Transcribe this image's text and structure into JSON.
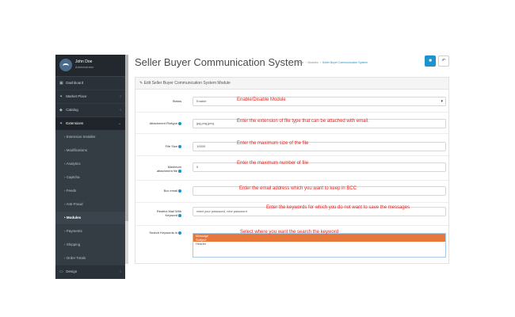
{
  "user": {
    "name": "John Doe",
    "role": "Administrator"
  },
  "sidebar": {
    "items": [
      {
        "label": "Dashboard",
        "icon": "dashboard-icon",
        "glyph": "▣",
        "arrow": ""
      },
      {
        "label": "Market Place",
        "icon": "puzzle-icon",
        "glyph": "✦",
        "arrow": "‹"
      },
      {
        "label": "Catalog",
        "icon": "tag-icon",
        "glyph": "◆",
        "arrow": "‹"
      },
      {
        "label": "Extensions",
        "icon": "puzzle-piece-icon",
        "glyph": "✦",
        "arrow": "⌄"
      }
    ],
    "subitems": [
      {
        "label": "Extension Installer"
      },
      {
        "label": "Modifications"
      },
      {
        "label": "Analytics"
      },
      {
        "label": "Captcha"
      },
      {
        "label": "Feeds"
      },
      {
        "label": "Anti-Fraud"
      },
      {
        "label": "Modules"
      },
      {
        "label": "Payments"
      },
      {
        "label": "Shipping"
      },
      {
        "label": "Order Totals"
      }
    ],
    "bottom": {
      "label": "Design",
      "icon": "monitor-icon",
      "glyph": "▭",
      "arrow": "‹"
    }
  },
  "header": {
    "title": "Seller Buyer Communication System",
    "breadcrumb": [
      "Home",
      "Modules",
      "Seller Buyer Communication System"
    ],
    "save_glyph": "■",
    "back_glyph": "↶"
  },
  "panel": {
    "heading": "Edit Seller Buyer Communication System Module",
    "status": {
      "label": "Status",
      "value": "Enable",
      "note": "Enable/Disable Module"
    },
    "attachment_filetype": {
      "label": "Attachment Filetype",
      "value": "jpg,png,jpeg",
      "note": "Enter the extension of file type that can be attached with email."
    },
    "file_size": {
      "label": "File Size",
      "value": "10000",
      "note": "Enter the maximum size of the file"
    },
    "max_attachment": {
      "label": "Maximum attachment file",
      "value": "5",
      "note": "Enter the maximum number of file"
    },
    "bcc_email": {
      "label": "Bcc email",
      "value": "",
      "note": "Enter the email address which you want to keep in BCC"
    },
    "restrict_keyword": {
      "label": "Restrict Mail With Keyword",
      "value": "reset your password, new password",
      "note": "Enter the keywords for which you do not want to save the messages"
    },
    "search_keyword": {
      "label": "Search Keywords in",
      "options": [
        "Message",
        "Subject",
        "Header"
      ],
      "selected": [
        0,
        1
      ],
      "note": "Select where you want the search the keyword"
    }
  },
  "colors": {
    "accent": "#1e91cf",
    "note": "#e8221c",
    "selected_option": "#e8773c",
    "sidebar": "#2a3138"
  }
}
